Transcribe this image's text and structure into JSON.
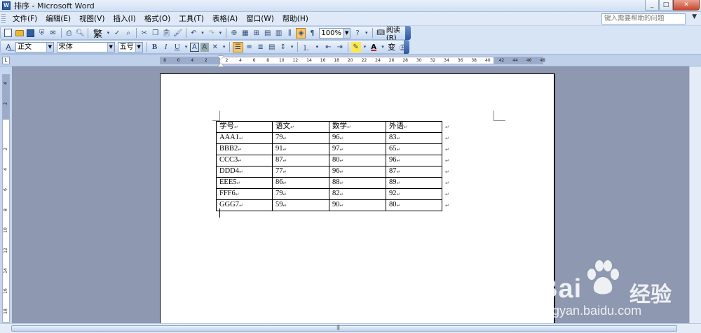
{
  "window": {
    "title": "排序 - Microsoft Word",
    "app_icon": "W"
  },
  "menu": {
    "items": [
      "文件(F)",
      "编辑(E)",
      "视图(V)",
      "插入(I)",
      "格式(O)",
      "工具(T)",
      "表格(A)",
      "窗口(W)",
      "帮助(H)"
    ],
    "help_placeholder": "键入需要帮助的问题"
  },
  "standard_toolbar": {
    "zoom": "100%",
    "read_label": "阅读(R)",
    "chinese_conv": "繁"
  },
  "formatting_toolbar": {
    "style": "正文",
    "font": "宋体",
    "size": "五号",
    "bold": "B",
    "italic": "I",
    "underline": "U",
    "char_border": "A",
    "char_shading": "A",
    "font_color_label": "A",
    "phonetic": "变"
  },
  "ruler": {
    "ticks": [
      "8",
      "6",
      "4",
      "2",
      "2",
      "4",
      "6",
      "8",
      "10",
      "12",
      "14",
      "16",
      "18",
      "20",
      "22",
      "24",
      "26",
      "28",
      "30",
      "32",
      "34",
      "36",
      "38",
      "40",
      "42",
      "44",
      "46",
      "48"
    ],
    "vticks": [
      "4",
      "2",
      "2",
      "4",
      "6",
      "8",
      "10",
      "12",
      "14",
      "16",
      "18"
    ]
  },
  "table": {
    "headers": [
      "学号",
      "语文",
      "数学",
      "外语"
    ],
    "rows": [
      [
        "AAA1",
        "79",
        "96",
        "83"
      ],
      [
        "BBB2",
        "91",
        "97",
        "65"
      ],
      [
        "CCC3",
        "87",
        "80",
        "96"
      ],
      [
        "DDD4",
        "77",
        "96",
        "87"
      ],
      [
        "EEE5",
        "86",
        "88",
        "89"
      ],
      [
        "FFF6",
        "79",
        "82",
        "92"
      ],
      [
        "GGG7",
        "59",
        "90",
        "80"
      ]
    ],
    "paragraph_mark": "↵"
  },
  "watermark": {
    "brand": "Bai",
    "brand_tail": "经验",
    "url": "jingyan.baidu.com"
  },
  "colors": {
    "accent": "#f4c46a",
    "doc_background": "#8e98b0"
  }
}
